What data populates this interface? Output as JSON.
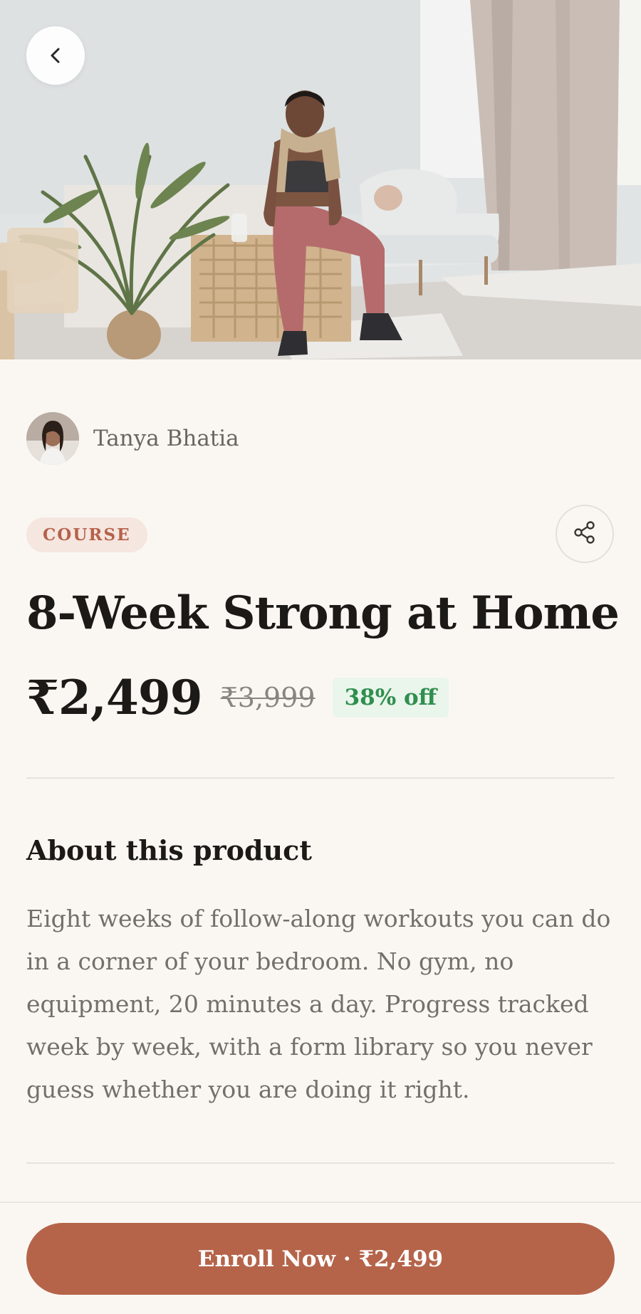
{
  "hero": {
    "image_description": "hero-photo",
    "back_icon": "chevron-left-icon"
  },
  "creator": {
    "name": "Tanya Bhatia",
    "avatar_icon": "avatar"
  },
  "product": {
    "type_badge": "COURSE",
    "title": "8-Week Strong at Home",
    "price": "₹2,499",
    "original_price": "₹3,999",
    "discount": "38% off",
    "share_icon": "share-icon"
  },
  "about": {
    "heading": "About this product",
    "body": "Eight weeks of follow-along workouts you can do in a corner of your bedroom. No gym, no equipment, 20 minutes a day. Progress tracked week by week, with a form library so you never guess whether you are doing it right."
  },
  "footer": {
    "enroll_label": "Enroll Now · ₹2,499"
  },
  "colors": {
    "background": "#faf7f3",
    "accent": "#b5644a",
    "badge_bg": "#f5e6df",
    "discount_green": "#2f8f4e",
    "discount_bg": "#eaf5ec"
  }
}
